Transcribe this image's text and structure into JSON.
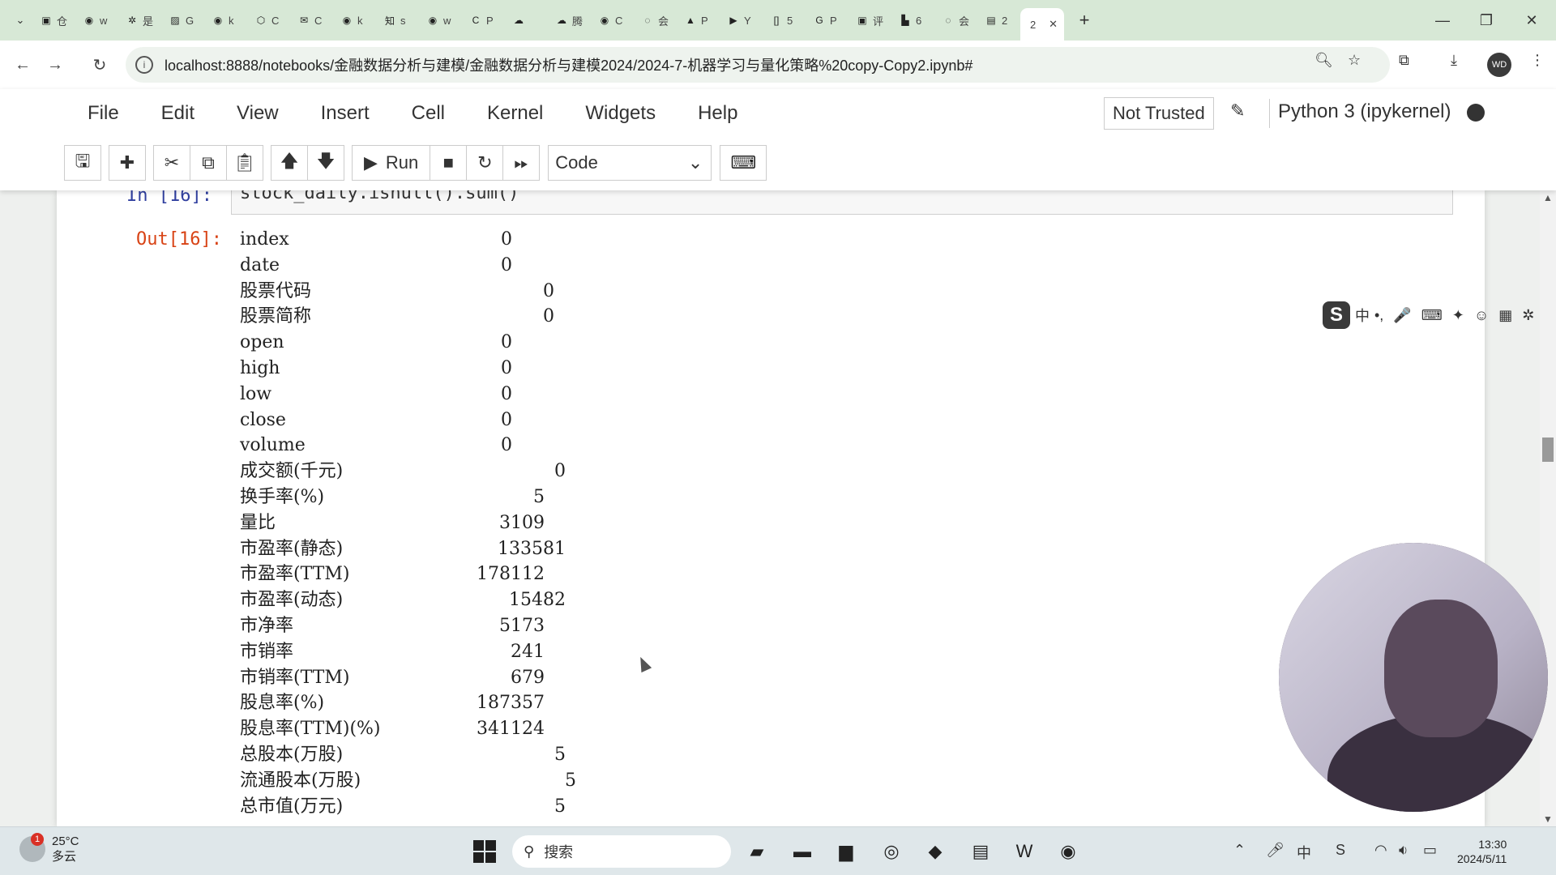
{
  "browser": {
    "tabs": [
      {
        "icon": "bilibili-icon",
        "glyph": "▣",
        "label": "仓"
      },
      {
        "icon": "github-icon",
        "glyph": "◉",
        "label": "w"
      },
      {
        "icon": "gear-icon",
        "glyph": "✲",
        "label": "是"
      },
      {
        "icon": "generic-icon",
        "glyph": "▨",
        "label": "G"
      },
      {
        "icon": "github-icon",
        "glyph": "◉",
        "label": "k"
      },
      {
        "icon": "cube-icon",
        "glyph": "⬡",
        "label": "C"
      },
      {
        "icon": "mail-icon",
        "glyph": "✉",
        "label": "C"
      },
      {
        "icon": "github-icon",
        "glyph": "◉",
        "label": "k"
      },
      {
        "icon": "zhihu-icon",
        "glyph": "知",
        "label": "s"
      },
      {
        "icon": "github-icon",
        "glyph": "◉",
        "label": "w"
      },
      {
        "icon": "code-icon",
        "glyph": "C",
        "label": "P"
      },
      {
        "icon": "cloud-icon",
        "glyph": "☁",
        "label": ""
      },
      {
        "icon": "cloud-icon",
        "glyph": "☁",
        "label": "腾"
      },
      {
        "icon": "github-icon",
        "glyph": "◉",
        "label": "C"
      },
      {
        "icon": "loading-icon",
        "glyph": "◌",
        "label": "会"
      },
      {
        "icon": "graduation-icon",
        "glyph": "▲",
        "label": "P"
      },
      {
        "icon": "youtube-icon",
        "glyph": "▶",
        "label": "Y"
      },
      {
        "icon": "bracket-icon",
        "glyph": "[]",
        "label": "5"
      },
      {
        "icon": "google-icon",
        "glyph": "G",
        "label": "P"
      },
      {
        "icon": "bilibili-icon",
        "glyph": "▣",
        "label": "评"
      },
      {
        "icon": "chart-icon",
        "glyph": "▙",
        "label": "6"
      },
      {
        "icon": "loading-icon",
        "glyph": "◌",
        "label": "会"
      },
      {
        "icon": "book-icon",
        "glyph": "▤",
        "label": "2"
      }
    ],
    "active_tab": {
      "label": "2",
      "close": "✕"
    },
    "new_tab": "+",
    "url": "localhost:8888/notebooks/金融数据分析与建模/金融数据分析与建模2024/2024-7-机器学习与量化策略%20copy-Copy2.ipynb#",
    "profile_initials": "WD"
  },
  "jupyter": {
    "menu": [
      "File",
      "Edit",
      "View",
      "Insert",
      "Cell",
      "Kernel",
      "Widgets",
      "Help"
    ],
    "trust_status": "Not Trusted",
    "kernel": "Python 3 (ipykernel)",
    "run_label": "Run",
    "cell_type": "Code"
  },
  "cell": {
    "in_prompt": "In  [16]:",
    "code": "stock_daily.isnull().sum()",
    "out_prompt": "Out[16]:",
    "rows": [
      {
        "name": "index",
        "value": "0"
      },
      {
        "name": "date",
        "value": "0"
      },
      {
        "name": "股票代码",
        "value": "0"
      },
      {
        "name": "股票简称",
        "value": "0"
      },
      {
        "name": "open",
        "value": "0"
      },
      {
        "name": "high",
        "value": "0"
      },
      {
        "name": "low",
        "value": "0"
      },
      {
        "name": "close",
        "value": "0"
      },
      {
        "name": "volume",
        "value": "0"
      },
      {
        "name": "成交额(千元)",
        "value": "0"
      },
      {
        "name": "换手率(%)",
        "value": "5"
      },
      {
        "name": "量比",
        "value": "3109"
      },
      {
        "name": "市盈率(静态)",
        "value": "133581"
      },
      {
        "name": "市盈率(TTM)",
        "value": "178112"
      },
      {
        "name": "市盈率(动态)",
        "value": "15482"
      },
      {
        "name": "市净率",
        "value": "5173"
      },
      {
        "name": "市销率",
        "value": "241"
      },
      {
        "name": "市销率(TTM)",
        "value": "679"
      },
      {
        "name": "股息率(%)",
        "value": "187357"
      },
      {
        "name": "股息率(TTM)(%)",
        "value": "341124"
      },
      {
        "name": "总股本(万股)",
        "value": "5"
      },
      {
        "name": "流通股本(万股)",
        "value": "5"
      },
      {
        "name": "总市值(万元)",
        "value": "5"
      }
    ]
  },
  "ime": {
    "mode": "中",
    "items": [
      "•,",
      "🎤",
      "⌨",
      "✦",
      "☺",
      "▦",
      "✲"
    ]
  },
  "taskbar": {
    "temperature": "25°C",
    "weather": "多云",
    "weather_badge": "1",
    "search_placeholder": "搜索",
    "time": "13:30",
    "date": "2024/5/11",
    "lang": "中"
  }
}
